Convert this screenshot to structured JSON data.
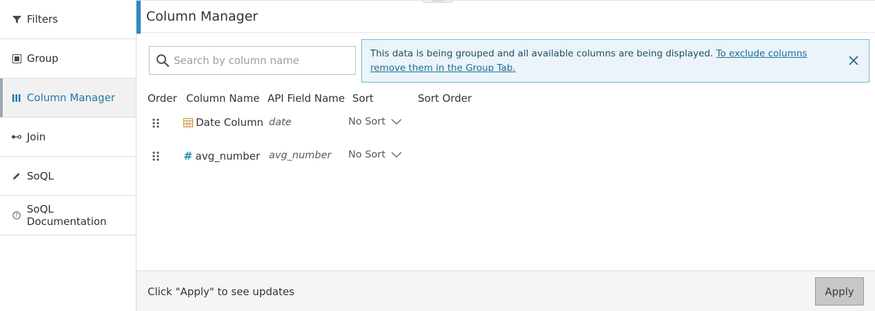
{
  "sidebar": {
    "items": [
      {
        "label": "Filters",
        "icon": "filter-icon"
      },
      {
        "label": "Group",
        "icon": "group-icon"
      },
      {
        "label": "Column Manager",
        "icon": "columns-icon",
        "active": true
      },
      {
        "label": "Join",
        "icon": "join-icon"
      },
      {
        "label": "SoQL",
        "icon": "pencil-icon"
      },
      {
        "label": "SoQL Documentation",
        "icon": "help-circle-icon"
      }
    ]
  },
  "header": {
    "title": "Column Manager"
  },
  "search": {
    "placeholder": "Search by column name",
    "value": ""
  },
  "banner": {
    "text": "This data is being grouped and all available columns are being displayed. ",
    "link": "To exclude columns remove them in the Group Tab."
  },
  "table": {
    "headers": [
      "Order",
      "Column Name",
      "API Field Name",
      "Sort",
      "Sort Order"
    ],
    "rows": [
      {
        "type_icon": "calendar-icon",
        "name": "Date Column",
        "api": "date",
        "sort": "No Sort"
      },
      {
        "type_icon": "number-icon",
        "name": "avg_number",
        "api": "avg_number",
        "sort": "No Sort"
      }
    ]
  },
  "footer": {
    "note": "Click \"Apply\" to see updates",
    "apply_label": "Apply"
  },
  "colors": {
    "accent": "#2d89c2",
    "active_text": "#1f76a8",
    "banner_bg": "#eaf4f9",
    "banner_border": "#6dbbd8"
  }
}
